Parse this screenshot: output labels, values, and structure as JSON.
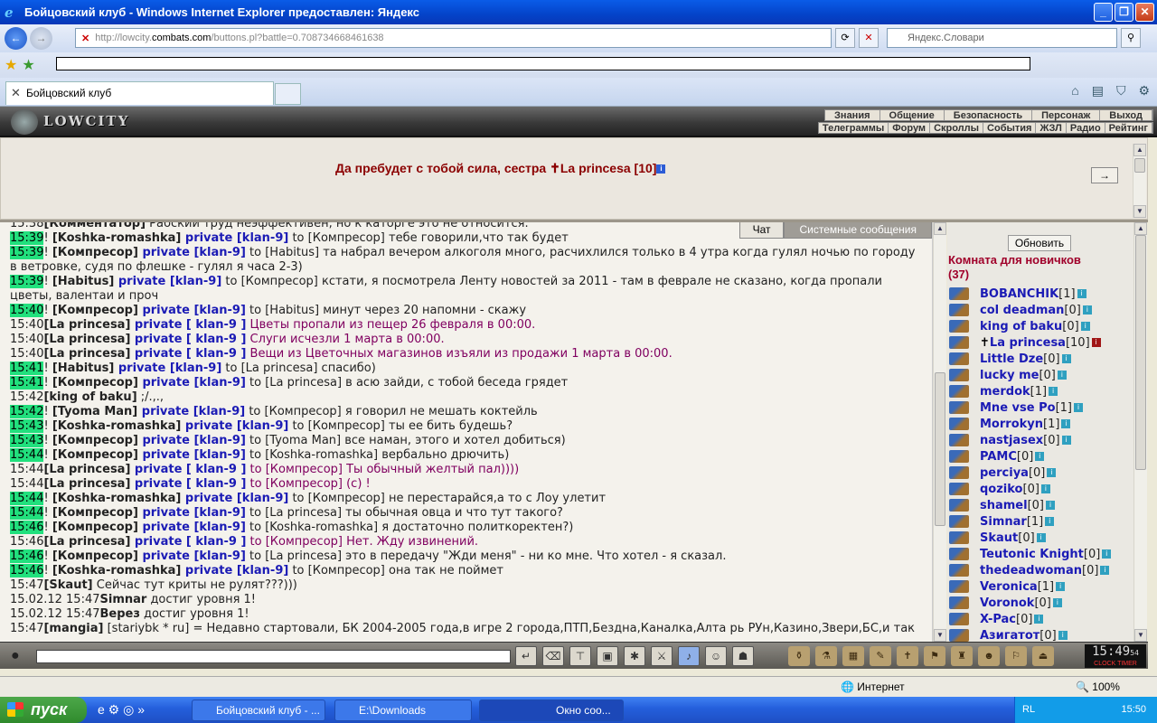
{
  "window": {
    "title": "Бойцовский клуб - Windows Internet Explorer предоставлен: Яндекс"
  },
  "browser": {
    "url_prefix": "http://lowcity.",
    "url_domain": "combats.com",
    "url_path": "/buttons.pl?battle=0.708734668461638",
    "search_placeholder": "Яндекс.Словари",
    "tab_title": "Бойцовский клуб"
  },
  "game": {
    "logo": "LOWCITY",
    "menu_top": [
      "Знания",
      "Общение",
      "Безопасность",
      "Персонаж",
      "Выход"
    ],
    "menu_bottom": [
      "Телеграммы",
      "Форум",
      "Скроллы",
      "События",
      "ЖЗЛ",
      "Радио",
      "Рейтинг"
    ],
    "welcome_prefix": "Да пребудет с тобой сила, сестра ",
    "welcome_cross": "✝",
    "welcome_name": "La princesa [10]",
    "arrow": "→",
    "chat_tab": "Чат",
    "system_tab": "Системные сообщения"
  },
  "chat": [
    {
      "time": "15:38",
      "hl": false,
      "parts": [
        [
          "n",
          "[Комментатор]"
        ],
        [
          "x",
          " Рабский труд неэффективен, но к каторге это не относится."
        ]
      ]
    },
    {
      "time": "15:39",
      "hl": true,
      "parts": [
        [
          "x",
          "! "
        ],
        [
          "n",
          "[Koshka-romashka]"
        ],
        [
          "p",
          " private [klan-9]"
        ],
        [
          "x",
          " to [Компресор] тебе говорили,что так будет"
        ]
      ]
    },
    {
      "time": "15:39",
      "hl": true,
      "parts": [
        [
          "x",
          "! "
        ],
        [
          "n",
          "[Компресор]"
        ],
        [
          "p",
          " private [klan-9]"
        ],
        [
          "x",
          " to [Habitus] та набрал вечером алкоголя много, расчихлился только в 4 утра когда гулял ночью по городу"
        ]
      ]
    },
    {
      "time": "",
      "hl": false,
      "parts": [
        [
          "x",
          "в ветровке, судя по флешке - гулял я часа 2-3)"
        ]
      ]
    },
    {
      "time": "15:39",
      "hl": true,
      "parts": [
        [
          "x",
          "! "
        ],
        [
          "n",
          "[Habitus]"
        ],
        [
          "p",
          " private [klan-9]"
        ],
        [
          "x",
          " to [Компресор] кстати, я посмотрела Ленту новостей за 2011 - там в феврале не сказано, когда пропали"
        ]
      ]
    },
    {
      "time": "",
      "hl": false,
      "parts": [
        [
          "x",
          "цветы, валентаи и проч"
        ]
      ]
    },
    {
      "time": "15:40",
      "hl": true,
      "parts": [
        [
          "x",
          "! "
        ],
        [
          "n",
          "[Компресор]"
        ],
        [
          "p",
          " private [klan-9]"
        ],
        [
          "x",
          " to [Habitus] минут через 20 напомни - скажу"
        ]
      ]
    },
    {
      "time": "15:40",
      "hl": false,
      "parts": [
        [
          "n",
          "[La princesa]"
        ],
        [
          "p",
          " private [ klan-9 ]"
        ],
        [
          "m",
          " Цветы пропали из пещер 26 февраля в 00:00."
        ]
      ]
    },
    {
      "time": "15:40",
      "hl": false,
      "parts": [
        [
          "n",
          "[La princesa]"
        ],
        [
          "p",
          " private [ klan-9 ]"
        ],
        [
          "m",
          " Слуги исчезли 1 марта в 00:00."
        ]
      ]
    },
    {
      "time": "15:40",
      "hl": false,
      "parts": [
        [
          "n",
          "[La princesa]"
        ],
        [
          "p",
          " private [ klan-9 ]"
        ],
        [
          "m",
          " Вещи из Цветочных магазинов изъяли из продажи 1 марта в 00:00."
        ]
      ]
    },
    {
      "time": "15:41",
      "hl": true,
      "parts": [
        [
          "x",
          "! "
        ],
        [
          "n",
          "[Habitus]"
        ],
        [
          "p",
          " private [klan-9]"
        ],
        [
          "x",
          " to [La princesa] спасибо)"
        ]
      ]
    },
    {
      "time": "15:41",
      "hl": true,
      "parts": [
        [
          "x",
          "! "
        ],
        [
          "n",
          "[Компресор]"
        ],
        [
          "p",
          " private [klan-9]"
        ],
        [
          "x",
          " to [La princesa] в асю зайди, с тобой беседа грядет"
        ]
      ]
    },
    {
      "time": "15:42",
      "hl": false,
      "parts": [
        [
          "n",
          "[king of baku]"
        ],
        [
          "x",
          " ;/.,.,"
        ]
      ]
    },
    {
      "time": "15:42",
      "hl": true,
      "parts": [
        [
          "x",
          "! "
        ],
        [
          "n",
          "[Tyoma Man]"
        ],
        [
          "p",
          " private [klan-9]"
        ],
        [
          "x",
          " to [Компресор] я говорил не мешать коктейль"
        ]
      ]
    },
    {
      "time": "15:43",
      "hl": true,
      "parts": [
        [
          "x",
          "! "
        ],
        [
          "n",
          "[Koshka-romashka]"
        ],
        [
          "p",
          " private [klan-9]"
        ],
        [
          "x",
          " to [Компресор] ты ее бить будешь?"
        ]
      ]
    },
    {
      "time": "15:43",
      "hl": true,
      "parts": [
        [
          "x",
          "! "
        ],
        [
          "n",
          "[Компресор]"
        ],
        [
          "p",
          " private [klan-9]"
        ],
        [
          "x",
          " to [Tyoma Man] все наман, этого и хотел добиться)"
        ]
      ]
    },
    {
      "time": "15:44",
      "hl": true,
      "parts": [
        [
          "x",
          "! "
        ],
        [
          "n",
          "[Компресор]"
        ],
        [
          "p",
          " private [klan-9]"
        ],
        [
          "x",
          " to [Koshka-romashka] вербально дрючить)"
        ]
      ]
    },
    {
      "time": "15:44",
      "hl": false,
      "parts": [
        [
          "n",
          "[La princesa]"
        ],
        [
          "p",
          " private [ klan-9 ]"
        ],
        [
          "m",
          " to [Компресор] Ты обычный желтый пал))))"
        ]
      ]
    },
    {
      "time": "15:44",
      "hl": false,
      "parts": [
        [
          "n",
          "[La princesa]"
        ],
        [
          "p",
          " private [ klan-9 ]"
        ],
        [
          "m",
          " to [Компресор] (с) !"
        ]
      ]
    },
    {
      "time": "15:44",
      "hl": true,
      "parts": [
        [
          "x",
          "! "
        ],
        [
          "n",
          "[Koshka-romashka]"
        ],
        [
          "p",
          " private [klan-9]"
        ],
        [
          "x",
          " to [Компресор] не перестарайся,а то с Лоу улетит"
        ]
      ]
    },
    {
      "time": "15:44",
      "hl": true,
      "parts": [
        [
          "x",
          "! "
        ],
        [
          "n",
          "[Компресор]"
        ],
        [
          "p",
          " private [klan-9]"
        ],
        [
          "x",
          " to [La princesa] ты обычная овца и что тут такого?"
        ]
      ]
    },
    {
      "time": "15:46",
      "hl": true,
      "parts": [
        [
          "x",
          "! "
        ],
        [
          "n",
          "[Компресор]"
        ],
        [
          "p",
          " private [klan-9]"
        ],
        [
          "x",
          " to [Koshka-romashka] я достаточно политкоректен?)"
        ]
      ]
    },
    {
      "time": "15:46",
      "hl": false,
      "parts": [
        [
          "n",
          "[La princesa]"
        ],
        [
          "p",
          " private [ klan-9 ]"
        ],
        [
          "m",
          " to [Компресор] Нет. Жду извинений."
        ]
      ]
    },
    {
      "time": "15:46",
      "hl": true,
      "parts": [
        [
          "x",
          "! "
        ],
        [
          "n",
          "[Компресор]"
        ],
        [
          "p",
          " private [klan-9]"
        ],
        [
          "x",
          " to [La princesa] это в передачу \"Жди меня\" - ни ко мне. Что хотел - я сказал."
        ]
      ]
    },
    {
      "time": "15:46",
      "hl": true,
      "parts": [
        [
          "x",
          "! "
        ],
        [
          "n",
          "[Koshka-romashka]"
        ],
        [
          "p",
          " private [klan-9]"
        ],
        [
          "x",
          " to [Компресор] она так не поймет"
        ]
      ]
    },
    {
      "time": "15:47",
      "hl": false,
      "parts": [
        [
          "n",
          "[Skaut]"
        ],
        [
          "x",
          " Сейчас тут криты не рулят???)))"
        ]
      ]
    },
    {
      "time": "15.02.12 15:47",
      "hl": false,
      "parts": [
        [
          "b",
          "Simnar"
        ],
        [
          "x",
          " достиг уровня 1!"
        ]
      ]
    },
    {
      "time": "15.02.12 15:47",
      "hl": false,
      "parts": [
        [
          "b",
          "Верез"
        ],
        [
          "x",
          " достиг уровня 1!"
        ]
      ]
    },
    {
      "time": "15:47",
      "hl": false,
      "parts": [
        [
          "n",
          "[mangia]"
        ],
        [
          "x",
          " [stariybk * ru] = Недавно стартовали, БК 2004-2005 года,в игре 2 города,ПТП,Бездна,Каналка,Алта рь РУн,Казино,Звери,БС,и так"
        ]
      ]
    }
  ],
  "room": {
    "refresh": "Обновить",
    "title": "Комната для новичков",
    "count": "(37)",
    "users": [
      {
        "name": "BOBANCHIK",
        "level": "[1]",
        "cross": false,
        "red": false
      },
      {
        "name": "col deadman",
        "level": "[0]",
        "cross": false,
        "red": false
      },
      {
        "name": "king of baku",
        "level": "[0]",
        "cross": false,
        "red": false
      },
      {
        "name": "La princesa",
        "level": "[10]",
        "cross": true,
        "red": true
      },
      {
        "name": "Little Dze",
        "level": "[0]",
        "cross": false,
        "red": false
      },
      {
        "name": "lucky me",
        "level": "[0]",
        "cross": false,
        "red": false
      },
      {
        "name": "merdok",
        "level": "[1]",
        "cross": false,
        "red": false
      },
      {
        "name": "Mne vse Po",
        "level": "[1]",
        "cross": false,
        "red": false
      },
      {
        "name": "Morrokyn",
        "level": "[1]",
        "cross": false,
        "red": false
      },
      {
        "name": "nastjasex",
        "level": "[0]",
        "cross": false,
        "red": false
      },
      {
        "name": "PAMC",
        "level": "[0]",
        "cross": false,
        "red": false
      },
      {
        "name": "perciya",
        "level": "[0]",
        "cross": false,
        "red": false
      },
      {
        "name": "qoziko",
        "level": "[0]",
        "cross": false,
        "red": false
      },
      {
        "name": "shamel",
        "level": "[0]",
        "cross": false,
        "red": false
      },
      {
        "name": "Simnar",
        "level": "[1]",
        "cross": false,
        "red": false
      },
      {
        "name": "Skaut",
        "level": "[0]",
        "cross": false,
        "red": false
      },
      {
        "name": "Teutonic Knight",
        "level": "[0]",
        "cross": false,
        "red": false
      },
      {
        "name": "thedeadwoman",
        "level": "[0]",
        "cross": false,
        "red": false
      },
      {
        "name": "Veronica",
        "level": "[1]",
        "cross": false,
        "red": false
      },
      {
        "name": "Voronok",
        "level": "[0]",
        "cross": false,
        "red": false
      },
      {
        "name": "X-Pac",
        "level": "[0]",
        "cross": false,
        "red": false
      },
      {
        "name": "Азигатот",
        "level": "[0]",
        "cross": false,
        "red": false
      }
    ]
  },
  "clock": {
    "time": "15:49",
    "sec": "54",
    "label": "CLOCK TIMER"
  },
  "status": {
    "zone": "Интернет",
    "zoom": "100%"
  },
  "taskbar": {
    "start": "пуск",
    "items": [
      "Бойцовский клуб - ...",
      "E:\\Downloads",
      "Окно соо..."
    ],
    "lang": "RL",
    "time": "15:50"
  },
  "colors": {
    "highlight": "#21e07d",
    "private": "#1b1bb5",
    "pm": "#800060",
    "room_title": "#a0002a"
  }
}
